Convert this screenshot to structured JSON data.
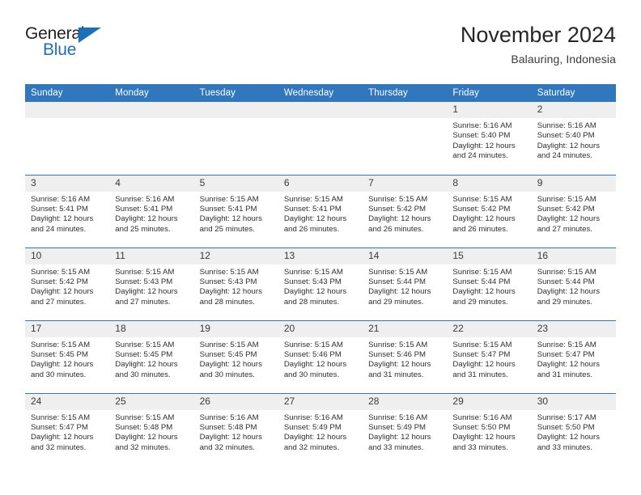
{
  "brand": {
    "name_top": "General",
    "name_bottom": "Blue",
    "accent_color": "#1d6fb8"
  },
  "header": {
    "title": "November 2024",
    "location": "Balauring, Indonesia"
  },
  "theme": {
    "header_blue": "#3077bd",
    "daynum_band": "#efefef",
    "text": "#2f2f2f"
  },
  "weekdays": [
    "Sunday",
    "Monday",
    "Tuesday",
    "Wednesday",
    "Thursday",
    "Friday",
    "Saturday"
  ],
  "labels": {
    "sunrise": "Sunrise:",
    "sunset": "Sunset:",
    "daylight": "Daylight:"
  },
  "weeks": [
    [
      {
        "day": "",
        "empty": true
      },
      {
        "day": "",
        "empty": true
      },
      {
        "day": "",
        "empty": true
      },
      {
        "day": "",
        "empty": true
      },
      {
        "day": "",
        "empty": true
      },
      {
        "day": "1",
        "sunrise": "Sunrise: 5:16 AM",
        "sunset": "Sunset: 5:40 PM",
        "daylight": "Daylight: 12 hours and 24 minutes."
      },
      {
        "day": "2",
        "sunrise": "Sunrise: 5:16 AM",
        "sunset": "Sunset: 5:40 PM",
        "daylight": "Daylight: 12 hours and 24 minutes."
      }
    ],
    [
      {
        "day": "3",
        "sunrise": "Sunrise: 5:16 AM",
        "sunset": "Sunset: 5:41 PM",
        "daylight": "Daylight: 12 hours and 24 minutes."
      },
      {
        "day": "4",
        "sunrise": "Sunrise: 5:16 AM",
        "sunset": "Sunset: 5:41 PM",
        "daylight": "Daylight: 12 hours and 25 minutes."
      },
      {
        "day": "5",
        "sunrise": "Sunrise: 5:15 AM",
        "sunset": "Sunset: 5:41 PM",
        "daylight": "Daylight: 12 hours and 25 minutes."
      },
      {
        "day": "6",
        "sunrise": "Sunrise: 5:15 AM",
        "sunset": "Sunset: 5:41 PM",
        "daylight": "Daylight: 12 hours and 26 minutes."
      },
      {
        "day": "7",
        "sunrise": "Sunrise: 5:15 AM",
        "sunset": "Sunset: 5:42 PM",
        "daylight": "Daylight: 12 hours and 26 minutes."
      },
      {
        "day": "8",
        "sunrise": "Sunrise: 5:15 AM",
        "sunset": "Sunset: 5:42 PM",
        "daylight": "Daylight: 12 hours and 26 minutes."
      },
      {
        "day": "9",
        "sunrise": "Sunrise: 5:15 AM",
        "sunset": "Sunset: 5:42 PM",
        "daylight": "Daylight: 12 hours and 27 minutes."
      }
    ],
    [
      {
        "day": "10",
        "sunrise": "Sunrise: 5:15 AM",
        "sunset": "Sunset: 5:42 PM",
        "daylight": "Daylight: 12 hours and 27 minutes."
      },
      {
        "day": "11",
        "sunrise": "Sunrise: 5:15 AM",
        "sunset": "Sunset: 5:43 PM",
        "daylight": "Daylight: 12 hours and 27 minutes."
      },
      {
        "day": "12",
        "sunrise": "Sunrise: 5:15 AM",
        "sunset": "Sunset: 5:43 PM",
        "daylight": "Daylight: 12 hours and 28 minutes."
      },
      {
        "day": "13",
        "sunrise": "Sunrise: 5:15 AM",
        "sunset": "Sunset: 5:43 PM",
        "daylight": "Daylight: 12 hours and 28 minutes."
      },
      {
        "day": "14",
        "sunrise": "Sunrise: 5:15 AM",
        "sunset": "Sunset: 5:44 PM",
        "daylight": "Daylight: 12 hours and 29 minutes."
      },
      {
        "day": "15",
        "sunrise": "Sunrise: 5:15 AM",
        "sunset": "Sunset: 5:44 PM",
        "daylight": "Daylight: 12 hours and 29 minutes."
      },
      {
        "day": "16",
        "sunrise": "Sunrise: 5:15 AM",
        "sunset": "Sunset: 5:44 PM",
        "daylight": "Daylight: 12 hours and 29 minutes."
      }
    ],
    [
      {
        "day": "17",
        "sunrise": "Sunrise: 5:15 AM",
        "sunset": "Sunset: 5:45 PM",
        "daylight": "Daylight: 12 hours and 30 minutes."
      },
      {
        "day": "18",
        "sunrise": "Sunrise: 5:15 AM",
        "sunset": "Sunset: 5:45 PM",
        "daylight": "Daylight: 12 hours and 30 minutes."
      },
      {
        "day": "19",
        "sunrise": "Sunrise: 5:15 AM",
        "sunset": "Sunset: 5:45 PM",
        "daylight": "Daylight: 12 hours and 30 minutes."
      },
      {
        "day": "20",
        "sunrise": "Sunrise: 5:15 AM",
        "sunset": "Sunset: 5:46 PM",
        "daylight": "Daylight: 12 hours and 30 minutes."
      },
      {
        "day": "21",
        "sunrise": "Sunrise: 5:15 AM",
        "sunset": "Sunset: 5:46 PM",
        "daylight": "Daylight: 12 hours and 31 minutes."
      },
      {
        "day": "22",
        "sunrise": "Sunrise: 5:15 AM",
        "sunset": "Sunset: 5:47 PM",
        "daylight": "Daylight: 12 hours and 31 minutes."
      },
      {
        "day": "23",
        "sunrise": "Sunrise: 5:15 AM",
        "sunset": "Sunset: 5:47 PM",
        "daylight": "Daylight: 12 hours and 31 minutes."
      }
    ],
    [
      {
        "day": "24",
        "sunrise": "Sunrise: 5:15 AM",
        "sunset": "Sunset: 5:47 PM",
        "daylight": "Daylight: 12 hours and 32 minutes."
      },
      {
        "day": "25",
        "sunrise": "Sunrise: 5:15 AM",
        "sunset": "Sunset: 5:48 PM",
        "daylight": "Daylight: 12 hours and 32 minutes."
      },
      {
        "day": "26",
        "sunrise": "Sunrise: 5:16 AM",
        "sunset": "Sunset: 5:48 PM",
        "daylight": "Daylight: 12 hours and 32 minutes."
      },
      {
        "day": "27",
        "sunrise": "Sunrise: 5:16 AM",
        "sunset": "Sunset: 5:49 PM",
        "daylight": "Daylight: 12 hours and 32 minutes."
      },
      {
        "day": "28",
        "sunrise": "Sunrise: 5:16 AM",
        "sunset": "Sunset: 5:49 PM",
        "daylight": "Daylight: 12 hours and 33 minutes."
      },
      {
        "day": "29",
        "sunrise": "Sunrise: 5:16 AM",
        "sunset": "Sunset: 5:50 PM",
        "daylight": "Daylight: 12 hours and 33 minutes."
      },
      {
        "day": "30",
        "sunrise": "Sunrise: 5:17 AM",
        "sunset": "Sunset: 5:50 PM",
        "daylight": "Daylight: 12 hours and 33 minutes."
      }
    ]
  ]
}
